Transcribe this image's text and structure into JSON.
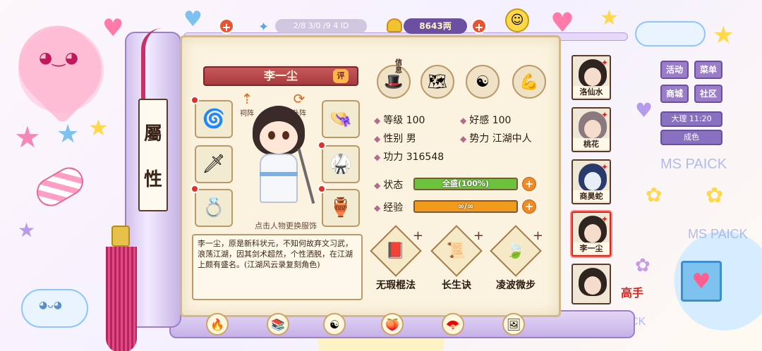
{
  "top_bar": {
    "info_text": "2/8 3/0 /9 4 ID",
    "currency_value": "8643两"
  },
  "character": {
    "name": "李一尘",
    "rank_badge": "评",
    "change_hint": "点击人物更换服饰",
    "description": "李一尘，原是新科状元，不知何故弃文习武，浪荡江湖，因其剑术超然，个性洒脱，在江湖上颇有盛名。(江湖风云录复刻角色)"
  },
  "attribute_label": [
    "屬",
    "性"
  ],
  "small_icons": [
    {
      "name": "祠阵",
      "glyph": "⇡"
    },
    {
      "name": "卦阵",
      "glyph": "⟳"
    }
  ],
  "tabs": [
    {
      "label": "信息",
      "icon": "hat-icon"
    },
    {
      "label": "",
      "icon": "map-icon"
    },
    {
      "label": "",
      "icon": "yinyang-icon"
    },
    {
      "label": "",
      "icon": "body-icon"
    }
  ],
  "stats": {
    "level_label": "等级",
    "level_value": "100",
    "affinity_label": "好感",
    "affinity_value": "100",
    "gender_label": "性别",
    "gender_value": "男",
    "faction_label": "势力",
    "faction_value": "江湖中人",
    "power_label": "功力",
    "power_value": "316548",
    "status_label": "状态",
    "status_text": "全盛(100%)",
    "status_fraction": 1.0,
    "exp_label": "经验",
    "exp_text": "∞/∞",
    "exp_fraction": 1.0
  },
  "skills": [
    {
      "name": "无瑕棍法",
      "icon": "book-icon"
    },
    {
      "name": "长生诀",
      "icon": "scroll-icon"
    },
    {
      "name": "凌波微步",
      "icon": "jade-icon"
    }
  ],
  "characters": [
    {
      "name": "洛仙水"
    },
    {
      "name": "桃花"
    },
    {
      "name": "商昊蛇"
    },
    {
      "name": "李一尘"
    },
    {
      "name": ""
    }
  ],
  "menu": {
    "activity": "活动",
    "menu": "菜单",
    "shop": "商城",
    "community": "社区",
    "map_label": "大理",
    "map_time": "11:20",
    "bottom_label": "成色"
  },
  "watermark": [
    "MS PAICK",
    "MS PAICK",
    "MS PAICK"
  ],
  "seal_text": "高手",
  "colors": {
    "status_bar": "#6cc23b",
    "exp_bar": "#f29a1c",
    "name_banner": "#b8474a",
    "menu_purple": "#9a7cc8"
  }
}
